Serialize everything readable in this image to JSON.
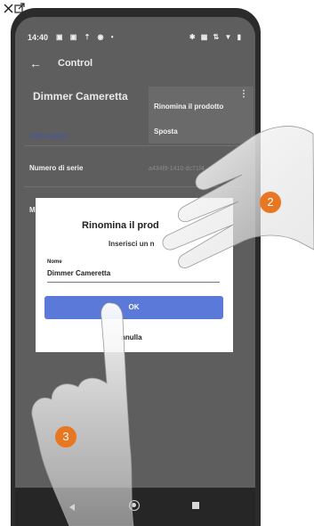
{
  "statusbar": {
    "time": "14:40",
    "left_icons": "▣ ▣ ⇡ ◉ •",
    "right_icons": "✱ ▦ ⇅ ▼ ▮"
  },
  "appbar": {
    "title": "Control",
    "back_icon": "←"
  },
  "device": {
    "name": "Dimmer Cameretta"
  },
  "overflow_menu": {
    "dots": "⋮",
    "rename": "Rinomina il prodotto",
    "move": "Sposta"
  },
  "tabs": {
    "info": "Informazioni"
  },
  "details": {
    "serial_label": "Numero di serie",
    "serial_value": "a434f9-1410-dc71f4",
    "model_label_partial": "M"
  },
  "dialog": {
    "title": "Rinomina il prod",
    "subtitle": "Inserisci un n",
    "field_label": "Nome",
    "field_value": "Dimmer Cameretta",
    "ok": "OK",
    "cancel": "nnulla"
  },
  "steps": {
    "step2": "2",
    "step3": "3"
  },
  "colors": {
    "accent": "#5a79d8",
    "badge": "#e87722",
    "info_tab": "#3f56b0"
  }
}
